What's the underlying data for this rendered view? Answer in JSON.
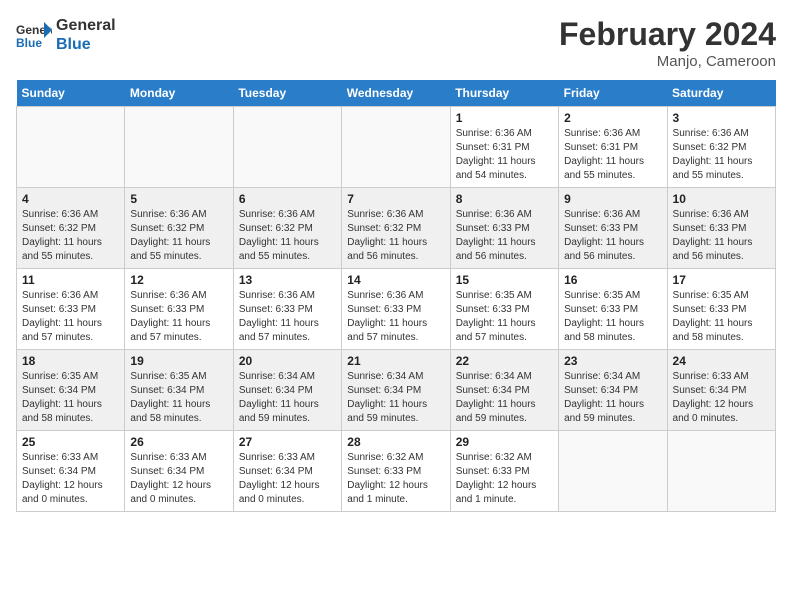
{
  "logo": {
    "line1": "General",
    "line2": "Blue"
  },
  "title": "February 2024",
  "subtitle": "Manjo, Cameroon",
  "days_of_week": [
    "Sunday",
    "Monday",
    "Tuesday",
    "Wednesday",
    "Thursday",
    "Friday",
    "Saturday"
  ],
  "weeks": [
    [
      {
        "day": "",
        "info": ""
      },
      {
        "day": "",
        "info": ""
      },
      {
        "day": "",
        "info": ""
      },
      {
        "day": "",
        "info": ""
      },
      {
        "day": "1",
        "info": "Sunrise: 6:36 AM\nSunset: 6:31 PM\nDaylight: 11 hours\nand 54 minutes."
      },
      {
        "day": "2",
        "info": "Sunrise: 6:36 AM\nSunset: 6:31 PM\nDaylight: 11 hours\nand 55 minutes."
      },
      {
        "day": "3",
        "info": "Sunrise: 6:36 AM\nSunset: 6:32 PM\nDaylight: 11 hours\nand 55 minutes."
      }
    ],
    [
      {
        "day": "4",
        "info": "Sunrise: 6:36 AM\nSunset: 6:32 PM\nDaylight: 11 hours\nand 55 minutes."
      },
      {
        "day": "5",
        "info": "Sunrise: 6:36 AM\nSunset: 6:32 PM\nDaylight: 11 hours\nand 55 minutes."
      },
      {
        "day": "6",
        "info": "Sunrise: 6:36 AM\nSunset: 6:32 PM\nDaylight: 11 hours\nand 55 minutes."
      },
      {
        "day": "7",
        "info": "Sunrise: 6:36 AM\nSunset: 6:32 PM\nDaylight: 11 hours\nand 56 minutes."
      },
      {
        "day": "8",
        "info": "Sunrise: 6:36 AM\nSunset: 6:33 PM\nDaylight: 11 hours\nand 56 minutes."
      },
      {
        "day": "9",
        "info": "Sunrise: 6:36 AM\nSunset: 6:33 PM\nDaylight: 11 hours\nand 56 minutes."
      },
      {
        "day": "10",
        "info": "Sunrise: 6:36 AM\nSunset: 6:33 PM\nDaylight: 11 hours\nand 56 minutes."
      }
    ],
    [
      {
        "day": "11",
        "info": "Sunrise: 6:36 AM\nSunset: 6:33 PM\nDaylight: 11 hours\nand 57 minutes."
      },
      {
        "day": "12",
        "info": "Sunrise: 6:36 AM\nSunset: 6:33 PM\nDaylight: 11 hours\nand 57 minutes."
      },
      {
        "day": "13",
        "info": "Sunrise: 6:36 AM\nSunset: 6:33 PM\nDaylight: 11 hours\nand 57 minutes."
      },
      {
        "day": "14",
        "info": "Sunrise: 6:36 AM\nSunset: 6:33 PM\nDaylight: 11 hours\nand 57 minutes."
      },
      {
        "day": "15",
        "info": "Sunrise: 6:35 AM\nSunset: 6:33 PM\nDaylight: 11 hours\nand 57 minutes."
      },
      {
        "day": "16",
        "info": "Sunrise: 6:35 AM\nSunset: 6:33 PM\nDaylight: 11 hours\nand 58 minutes."
      },
      {
        "day": "17",
        "info": "Sunrise: 6:35 AM\nSunset: 6:33 PM\nDaylight: 11 hours\nand 58 minutes."
      }
    ],
    [
      {
        "day": "18",
        "info": "Sunrise: 6:35 AM\nSunset: 6:34 PM\nDaylight: 11 hours\nand 58 minutes."
      },
      {
        "day": "19",
        "info": "Sunrise: 6:35 AM\nSunset: 6:34 PM\nDaylight: 11 hours\nand 58 minutes."
      },
      {
        "day": "20",
        "info": "Sunrise: 6:34 AM\nSunset: 6:34 PM\nDaylight: 11 hours\nand 59 minutes."
      },
      {
        "day": "21",
        "info": "Sunrise: 6:34 AM\nSunset: 6:34 PM\nDaylight: 11 hours\nand 59 minutes."
      },
      {
        "day": "22",
        "info": "Sunrise: 6:34 AM\nSunset: 6:34 PM\nDaylight: 11 hours\nand 59 minutes."
      },
      {
        "day": "23",
        "info": "Sunrise: 6:34 AM\nSunset: 6:34 PM\nDaylight: 11 hours\nand 59 minutes."
      },
      {
        "day": "24",
        "info": "Sunrise: 6:33 AM\nSunset: 6:34 PM\nDaylight: 12 hours\nand 0 minutes."
      }
    ],
    [
      {
        "day": "25",
        "info": "Sunrise: 6:33 AM\nSunset: 6:34 PM\nDaylight: 12 hours\nand 0 minutes."
      },
      {
        "day": "26",
        "info": "Sunrise: 6:33 AM\nSunset: 6:34 PM\nDaylight: 12 hours\nand 0 minutes."
      },
      {
        "day": "27",
        "info": "Sunrise: 6:33 AM\nSunset: 6:34 PM\nDaylight: 12 hours\nand 0 minutes."
      },
      {
        "day": "28",
        "info": "Sunrise: 6:32 AM\nSunset: 6:33 PM\nDaylight: 12 hours\nand 1 minute."
      },
      {
        "day": "29",
        "info": "Sunrise: 6:32 AM\nSunset: 6:33 PM\nDaylight: 12 hours\nand 1 minute."
      },
      {
        "day": "",
        "info": ""
      },
      {
        "day": "",
        "info": ""
      }
    ]
  ]
}
